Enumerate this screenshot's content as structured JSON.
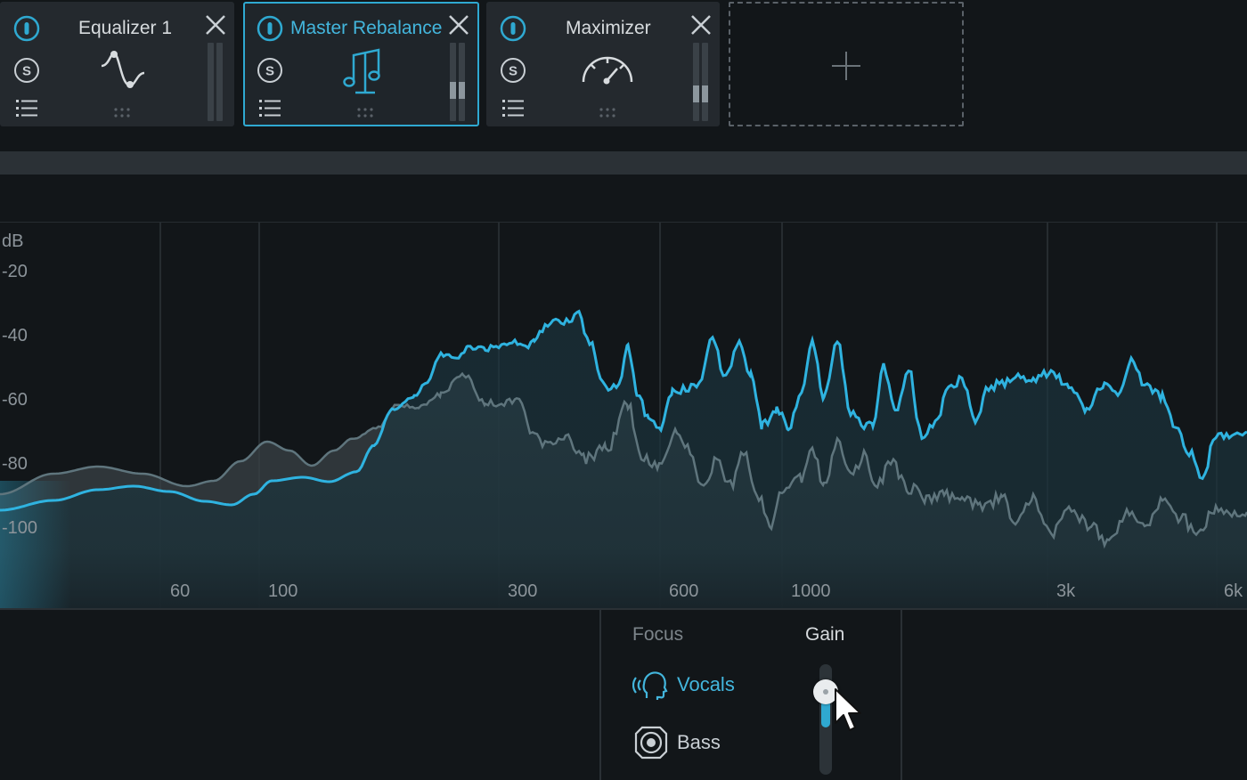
{
  "modules": [
    {
      "name": "Equalizer 1",
      "selected": false,
      "meter_level": 0.0,
      "icon": "eq-curve-icon"
    },
    {
      "name": "Master Rebalance",
      "selected": true,
      "meter_level": 0.5,
      "icon": "music-note-icon"
    },
    {
      "name": "Maximizer",
      "selected": false,
      "meter_level": 0.45,
      "icon": "gauge-icon"
    }
  ],
  "add_module": {
    "icon": "plus-icon"
  },
  "spectrum": {
    "db_unit": "dB",
    "db_ticks": [
      "-20",
      "-40",
      "-60",
      "-80",
      "-100"
    ],
    "freq_ticks": [
      "60",
      "100",
      "300",
      "600",
      "1000",
      "3k",
      "6k"
    ],
    "colors": {
      "processed": "#2fb3e0",
      "original": "#5f757d"
    }
  },
  "rebalance": {
    "focus_label": "Focus",
    "gain_label": "Gain",
    "focus_options": [
      {
        "label": "Vocals",
        "active": true,
        "icon": "vocals-head-icon"
      },
      {
        "label": "Bass",
        "active": false,
        "icon": "speaker-icon"
      }
    ],
    "gain_level": 0.75
  },
  "colors": {
    "accent": "#2fa9d1",
    "background": "#121619",
    "module_bg": "#24292e"
  }
}
